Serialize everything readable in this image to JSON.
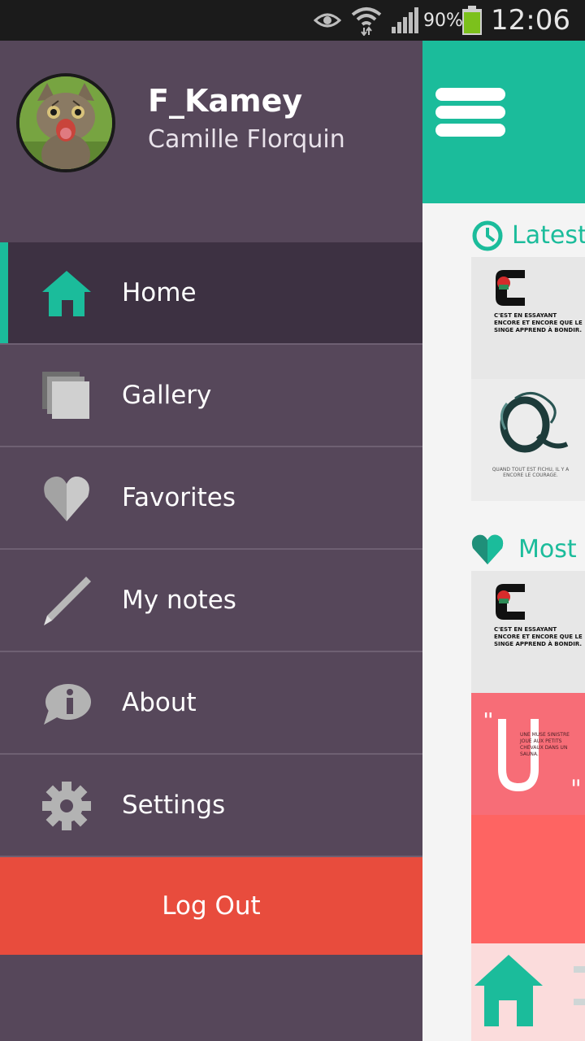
{
  "status_bar": {
    "icons": [
      "eye-icon",
      "wifi-icon",
      "signal-icon",
      "battery-icon"
    ],
    "battery_percent": "90%",
    "time": "12:06"
  },
  "drawer": {
    "profile": {
      "username": "F_Kamey",
      "full_name": "Camille Florquin"
    },
    "items": [
      {
        "label": "Home",
        "icon": "home-icon",
        "active": true
      },
      {
        "label": "Gallery",
        "icon": "gallery-icon",
        "active": false
      },
      {
        "label": "Favorites",
        "icon": "heart-icon",
        "active": false
      },
      {
        "label": "My notes",
        "icon": "pencil-icon",
        "active": false
      },
      {
        "label": "About",
        "icon": "info-icon",
        "active": false
      },
      {
        "label": "Settings",
        "icon": "gear-icon",
        "active": false
      }
    ],
    "logout_label": "Log Out"
  },
  "main": {
    "latest_title": "Latest",
    "most_title": "Most",
    "cards": [
      {
        "quote": "C'EST EN ESSAYANT ENCORE ET ENCORE QUE LE SINGE APPREND À BONDIR."
      },
      {
        "caption": "QUAND TOUT EST FICHU, IL Y A ENCORE LE COURAGE."
      },
      {
        "quote": "C'EST EN ESSAYANT ENCORE ET ENCORE QUE LE SINGE APPREND À BONDIR."
      },
      {
        "caption": "UNE MUSE SINISTRE JOUE AUX PETITS CHEVAUX DANS UN SAUNA."
      }
    ]
  },
  "colors": {
    "accent": "#1bbc9b",
    "drawer_bg": "#56475a",
    "drawer_active": "#3d3142",
    "logout": "#e84c3d",
    "status_bar": "#1b1b1b"
  }
}
